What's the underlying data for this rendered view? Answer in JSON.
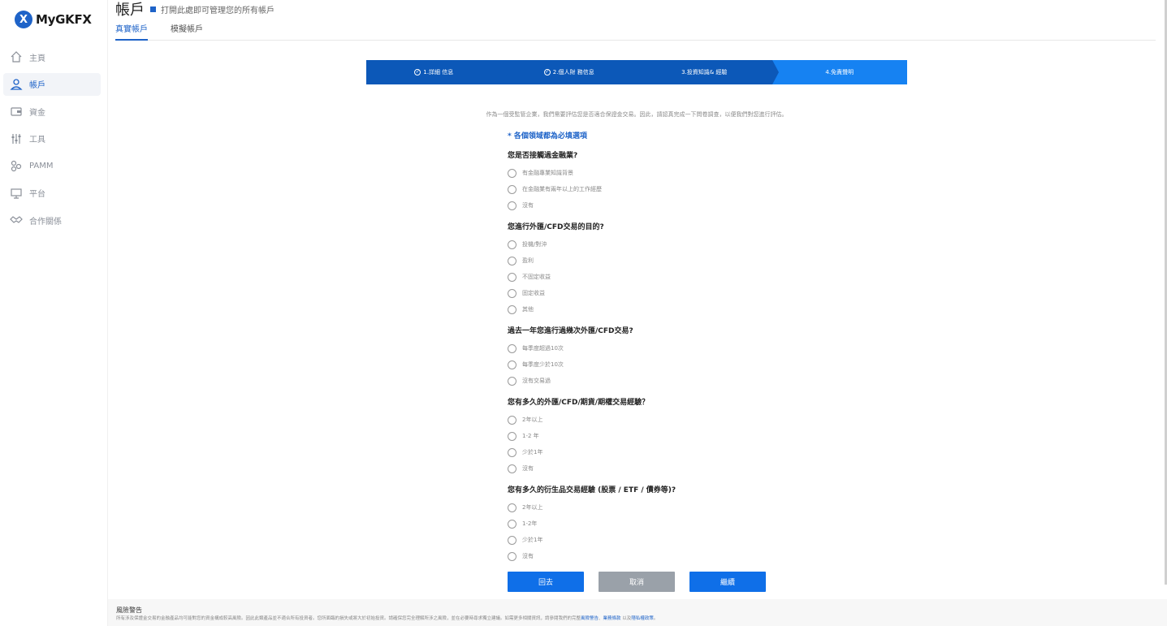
{
  "brand": {
    "logo_mark": "X",
    "logo_text": "MyGKFX"
  },
  "sidebar": {
    "items": [
      {
        "label": "主頁",
        "icon": "home-icon"
      },
      {
        "label": "帳戶",
        "icon": "user-icon",
        "active": true
      },
      {
        "label": "資金",
        "icon": "wallet-icon"
      },
      {
        "label": "工具",
        "icon": "sliders-icon"
      },
      {
        "label": "PAMM",
        "icon": "people-icon"
      },
      {
        "label": "平台",
        "icon": "monitor-icon"
      },
      {
        "label": "合作關係",
        "icon": "handshake-icon"
      }
    ]
  },
  "header": {
    "title": "帳戶",
    "subtitle": "打開此處即可管理您的所有帳戶",
    "tabs": [
      {
        "label": "真實帳戶",
        "active": true
      },
      {
        "label": "模擬帳戶"
      }
    ]
  },
  "stepper": {
    "steps": [
      {
        "label": "1.詳細 信息",
        "done": true
      },
      {
        "label": "2.個人財 務信息",
        "done": true
      },
      {
        "label": "3.投資知識& 經驗",
        "done": false
      },
      {
        "label": "4.免責聲明",
        "done": false
      }
    ]
  },
  "form": {
    "intro": "作為一個受監管企業，我們需要評估您是否適合保證金交易。因此，請認真完成一下問卷調查，以便我們對您進行評估。",
    "required_note": "* 各個領域都為必填選項",
    "questions": [
      {
        "title": "您是否接觸過金融業?",
        "options": [
          "有金融專業知識背景",
          "在金融業有兩年以上的工作經歷",
          "沒有"
        ]
      },
      {
        "title": "您進行外匯/CFD交易的目的?",
        "options": [
          "投機/對沖",
          "盈利",
          "不固定收益",
          "固定收益",
          "其他"
        ]
      },
      {
        "title": "過去一年您進行過幾次外匯/CFD交易?",
        "options": [
          "每季度超過10次",
          "每季度少於10次",
          "沒有交易過"
        ]
      },
      {
        "title": "您有多久的外匯/CFD/期貨/期權交易經驗？",
        "options": [
          "2年以上",
          "1-2 年",
          "少於1年",
          "沒有"
        ]
      },
      {
        "title": "您有多久的衍生品交易經驗 (股票 / ETF / 債券等)?",
        "options": [
          "2年以上",
          "1-2年",
          "少於1年",
          "沒有"
        ]
      }
    ]
  },
  "buttons": {
    "back": "回去",
    "cancel": "取消",
    "continue": "繼續"
  },
  "footer": {
    "risk_title": "風險警告",
    "risk_text": "所有涉及保證金交易的金融產品均可能對您的資金構成較高風險。因此此類產品並不適合所有投資者。您所面臨的損失或將大於初始投資。請確保您完全理解所涉之風險，並在必要時尋求獨立建議。如需更多相關資訊，請參閱我們的完整",
    "link1": "風險警告",
    "sep1": "、",
    "link2": "業務條款",
    "sep2": " 以及",
    "link3": "隱私權政策",
    "end": "。"
  },
  "colors": {
    "primary": "#0c58b8",
    "step_active": "#1682f2",
    "button_blue": "#0f6fe8",
    "button_gray": "#9aa1a9"
  }
}
